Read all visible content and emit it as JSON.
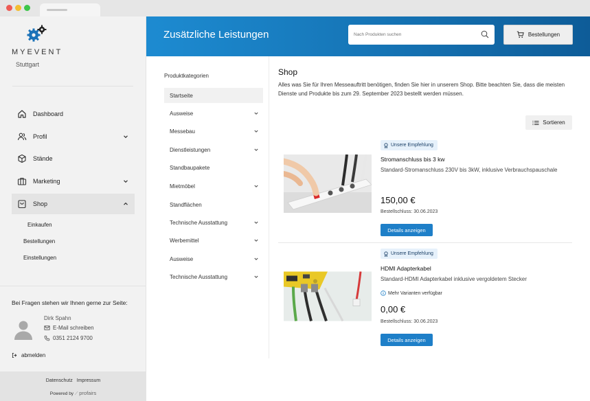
{
  "brand": {
    "name": "MYEVENT",
    "city": "Stuttgart"
  },
  "sidebar": {
    "items": [
      {
        "label": "Dashboard",
        "icon": "home-icon"
      },
      {
        "label": "Profil",
        "icon": "users-icon"
      },
      {
        "label": "Stände",
        "icon": "box-icon"
      },
      {
        "label": "Marketing",
        "icon": "briefcase-icon"
      },
      {
        "label": "Shop",
        "icon": "bag-icon"
      }
    ],
    "subitems": [
      "Einkaufen",
      "Bestellungen",
      "Einstellungen"
    ],
    "help_text": "Bei Fragen stehen wir Ihnen gerne zur Seite:",
    "contact": {
      "name": "Dirk Spahn",
      "email_label": "E-Mail schreiben",
      "phone": "0351 2124 9700"
    },
    "logout_label": "abmelden",
    "footer": {
      "privacy": "Datenschutz",
      "imprint": "Impressum",
      "powered_by": "Powered by",
      "vendor": "profairs"
    }
  },
  "header": {
    "title": "Zusätzliche Leistungen",
    "search_placeholder": "Nach Produkten suchen",
    "orders_label": "Bestellungen"
  },
  "categories": {
    "title": "Produktkategorien",
    "items": [
      {
        "label": "Startseite"
      },
      {
        "label": "Ausweise"
      },
      {
        "label": "Messebau"
      },
      {
        "label": "Dienstleistungen"
      },
      {
        "label": "Standbaupakete"
      },
      {
        "label": "Mietmöbel"
      },
      {
        "label": "Standflächen"
      },
      {
        "label": "Technische Ausstattung"
      },
      {
        "label": "Werbemittel"
      },
      {
        "label": "Ausweise"
      },
      {
        "label": "Technische Ausstattung"
      }
    ]
  },
  "shop": {
    "title": "Shop",
    "description": "Alles was Sie für Ihren Messeauftritt benötigen, finden Sie hier in unserem Shop. Bitte beachten Sie, dass die meisten Dienste und Produkte bis zum 29. September 2023 bestellt werden müssen.",
    "sort_label": "Sortieren",
    "products": [
      {
        "badge": "Unsere Empfehlung",
        "name": "Stromanschluss bis 3 kw",
        "description": "Standard-Stromanschluss 230V bis 3kW, inklusive Verbrauchspauschale",
        "price": "150,00 €",
        "deadline": "Bestellschluss: 30.06.2023",
        "button": "Details anzeigen"
      },
      {
        "badge": "Unsere Empfehlung",
        "name": "HDMI Adapterkabel",
        "description": "Standard-HDMI Adapterkabel inklusive vergoldetem Stecker",
        "variants": "Mehr Varianten verfügbar",
        "price": "0,00 €",
        "deadline": "Bestellschluss: 30.06.2023",
        "button": "Details anzeigen"
      }
    ]
  },
  "colors": {
    "header_start": "#1d8bd1",
    "header_end": "#0e5c98",
    "button": "#1e7fc8",
    "badge_bg": "#e6f1fb"
  }
}
